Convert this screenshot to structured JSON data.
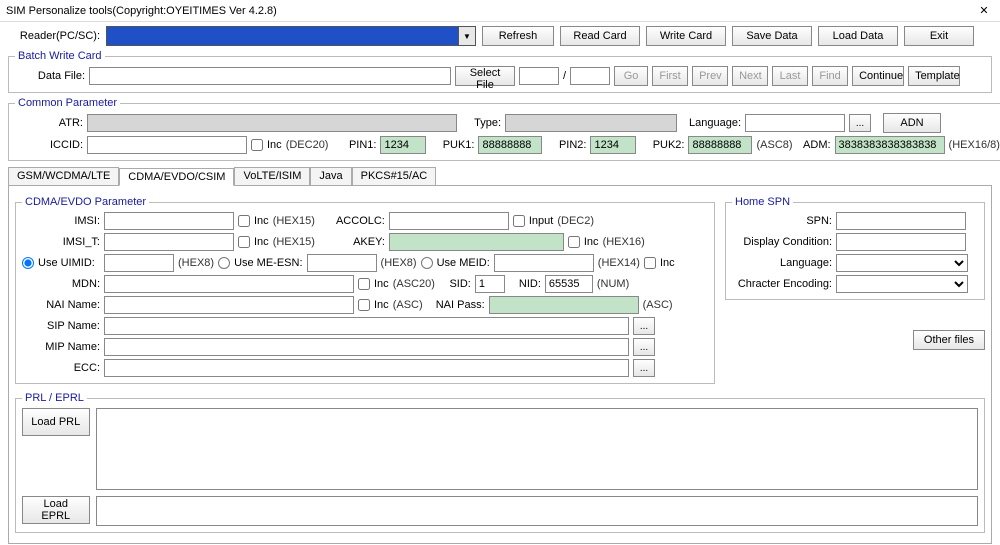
{
  "window": {
    "title": "SIM Personalize tools(Copyright:OYEITIMES Ver 4.2.8)"
  },
  "reader": {
    "label": "Reader(PC/SC):",
    "refresh": "Refresh",
    "read_card": "Read Card",
    "write_card": "Write Card",
    "save_data": "Save Data",
    "load_data": "Load Data",
    "exit": "Exit"
  },
  "batch": {
    "legend": "Batch Write Card",
    "data_file": "Data File:",
    "select_file": "Select File",
    "slash": "/",
    "go": "Go",
    "first": "First",
    "prev": "Prev",
    "next": "Next",
    "last": "Last",
    "find": "Find",
    "continue": "Continue",
    "template": "Template"
  },
  "common": {
    "legend": "Common Parameter",
    "atr": "ATR:",
    "type": "Type:",
    "language": "Language:",
    "dots": "...",
    "adn": "ADN",
    "iccid": "ICCID:",
    "inc": "Inc",
    "dec20": "(DEC20)",
    "pin1": "PIN1:",
    "pin1_val": "1234",
    "puk1": "PUK1:",
    "puk1_val": "88888888",
    "pin2": "PIN2:",
    "pin2_val": "1234",
    "puk2": "PUK2:",
    "puk2_val": "88888888",
    "asc8": "(ASC8)",
    "adm": "ADM:",
    "adm_val": "3838383838383838",
    "hex168": "(HEX16/8)"
  },
  "tabs": {
    "t0": "GSM/WCDMA/LTE",
    "t1": "CDMA/EVDO/CSIM",
    "t2": "VoLTE/ISIM",
    "t3": "Java",
    "t4": "PKCS#15/AC"
  },
  "cdma": {
    "legend": "CDMA/EVDO Parameter",
    "imsi": "IMSI:",
    "inc": "Inc",
    "hex15": "(HEX15)",
    "accolc": "ACCOLC:",
    "input": "Input",
    "dec2": "(DEC2)",
    "imsi_t": "IMSI_T:",
    "akey": "AKEY:",
    "hex16": "(HEX16)",
    "use_uimid": "Use UIMID:",
    "hex8": "(HEX8)",
    "use_meesn": "Use ME-ESN:",
    "use_meid": "Use MEID:",
    "hex14": "(HEX14)",
    "mdn": "MDN:",
    "asc20": "(ASC20)",
    "sid": "SID:",
    "sid_val": "1",
    "nid": "NID:",
    "nid_val": "65535",
    "num": "(NUM)",
    "nai_name": "NAI Name:",
    "asc": "(ASC)",
    "nai_pass": "NAI Pass:",
    "sip_name": "SIP Name:",
    "mip_name": "MIP Name:",
    "ecc": "ECC:",
    "dots": "..."
  },
  "homespn": {
    "legend": "Home SPN",
    "spn": "SPN:",
    "display": "Display Condition:",
    "language": "Language:",
    "enc": "Chracter Encoding:"
  },
  "other_files": "Other files",
  "prl": {
    "legend": "PRL / EPRL",
    "load_prl": "Load PRL",
    "load_eprl": "Load EPRL"
  }
}
